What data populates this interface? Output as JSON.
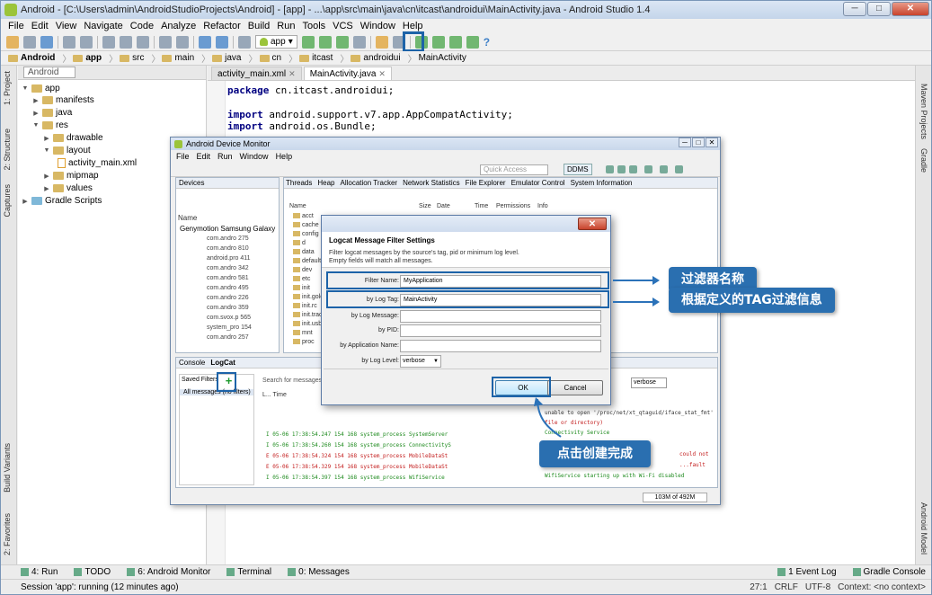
{
  "window": {
    "title": "Android - [C:\\Users\\admin\\AndroidStudioProjects\\Android] - [app] - ...\\app\\src\\main\\java\\cn\\itcast\\androidui\\MainActivity.java - Android Studio 1.4",
    "min": "─",
    "max": "□",
    "close": "✕"
  },
  "menubar": [
    "File",
    "Edit",
    "View",
    "Navigate",
    "Code",
    "Analyze",
    "Refactor",
    "Build",
    "Run",
    "Tools",
    "VCS",
    "Window",
    "Help"
  ],
  "toolbar": {
    "run_config": "app",
    "help": "?"
  },
  "breadcrumb": [
    "Android",
    "app",
    "src",
    "main",
    "java",
    "cn",
    "itcast",
    "androidui",
    "MainActivity"
  ],
  "left_tabs": [
    "1: Project",
    "2: Structure",
    "Captures",
    "Build Variants",
    "2: Favorites"
  ],
  "right_tabs": [
    "Maven Projects",
    "Gradle",
    "Android Model"
  ],
  "project": {
    "view_combo": "Android",
    "tree": [
      {
        "label": "app",
        "depth": 0
      },
      {
        "label": "manifests",
        "depth": 1
      },
      {
        "label": "java",
        "depth": 1
      },
      {
        "label": "res",
        "depth": 1
      },
      {
        "label": "drawable",
        "depth": 2
      },
      {
        "label": "layout",
        "depth": 2
      },
      {
        "label": "activity_main.xml",
        "depth": 3
      },
      {
        "label": "mipmap",
        "depth": 2
      },
      {
        "label": "values",
        "depth": 2
      },
      {
        "label": "Gradle Scripts",
        "depth": 0
      }
    ]
  },
  "editor": {
    "tabs": [
      "activity_main.xml",
      "MainActivity.java"
    ],
    "code": [
      {
        "kw": "package",
        "rest": " cn.itcast.androidui;"
      },
      {
        "kw": "import",
        "rest": " android.support.v7.app.AppCompatActivity;"
      },
      {
        "kw": "import",
        "rest": " android.os.Bundle;"
      }
    ]
  },
  "device_monitor": {
    "title": "Android Device Monitor",
    "menu": [
      "File",
      "Edit",
      "Run",
      "Window",
      "Help"
    ],
    "quick_access": "Quick Access",
    "ddms": "DDMS",
    "devices_tab": "Devices",
    "name_col": "Name",
    "device": "Genymotion Samsung Galaxy",
    "processes": [
      "com.andro 275",
      "com.andro 810",
      "android.pro 411",
      "com.andro 342",
      "com.andro 581",
      "com.andro 495",
      "com.andro 226",
      "com.andro 359",
      "com.svox.p 565",
      "system_pro 154",
      "com.andro 257"
    ],
    "fe_tabs": [
      "Threads",
      "Heap",
      "Allocation Tracker",
      "Network Statistics",
      "File Explorer",
      "Emulator Control",
      "System Information"
    ],
    "fe_cols": [
      "Name",
      "Size",
      "Date",
      "Time",
      "Permissions",
      "Info"
    ],
    "fe_rows": [
      "acct",
      "cache",
      "config",
      "d",
      "data",
      "default",
      "dev",
      "etc",
      "init",
      "init.goldfish",
      "init.rc",
      "init.trace",
      "init.usb",
      "mnt",
      "proc"
    ],
    "console_tabs": [
      "Console",
      "LogCat"
    ],
    "saved_filters": "Saved Filters",
    "add_filter": "+",
    "all_messages": "All messages (no filters)",
    "search_placeholder": "Search for messages. Accepts Java regexes.",
    "log_level": "verbose",
    "log_head": "L...  Time",
    "log_lines": [
      {
        "text": "I  05-06 17:38:54.247   154   168  system_process   SystemServer",
        "cls": "g"
      },
      {
        "text": "I  05-06 17:38:54.260   154   168  system_process   ConnectivityS",
        "cls": "g"
      },
      {
        "text": "E  05-06 17:38:54.324   154   168  system_process   MobileDataSt",
        "cls": "r"
      },
      {
        "text": "E  05-06 17:38:54.329   154   168  system_process   MobileDataSt",
        "cls": "r"
      },
      {
        "text": "I  05-06 17:38:54.397   154   168  system_process   WifiService",
        "cls": "g"
      }
    ],
    "log_right": [
      "unable to open '/proc/net/xt_qtaguid/iface_stat_fmt'",
      "file or directory)",
      "Connectivity Service",
      "could not",
      "...fault",
      "WifiService starting up with Wi-Fi disabled"
    ],
    "memory": "103M of 492M"
  },
  "dialog": {
    "title": "Logcat Message Filter Settings",
    "desc1": "Filter logcat messages by the source's tag, pid or minimum log level.",
    "desc2": "Empty fields will match all messages.",
    "fields": [
      {
        "label": "Filter Name:",
        "value": "MyApplication"
      },
      {
        "label": "by Log Tag:",
        "value": "MainActivity"
      },
      {
        "label": "by Log Message:",
        "value": ""
      },
      {
        "label": "by PID:",
        "value": ""
      },
      {
        "label": "by Application Name:",
        "value": ""
      }
    ],
    "level_label": "by Log Level:",
    "level_value": "verbose",
    "ok": "OK",
    "cancel": "Cancel",
    "close": "✕"
  },
  "callouts": {
    "filter_name": "过滤器名称",
    "tag_filter": "根据定义的TAG过滤信息",
    "click_ok": "点击创建完成"
  },
  "bottom_tools": [
    "4: Run",
    "TODO",
    "6: Android Monitor",
    "Terminal",
    "0: Messages"
  ],
  "bottom_right": [
    "1 Event Log",
    "Gradle Console"
  ],
  "status": {
    "message": "Session 'app': running (12 minutes ago)",
    "pos": "27:1",
    "crlf": "CRLF",
    "encoding": "UTF-8",
    "context": "Context: <no context>"
  },
  "colors": {
    "accent": "#2a6fb0",
    "highlight": "#1d63a8"
  }
}
